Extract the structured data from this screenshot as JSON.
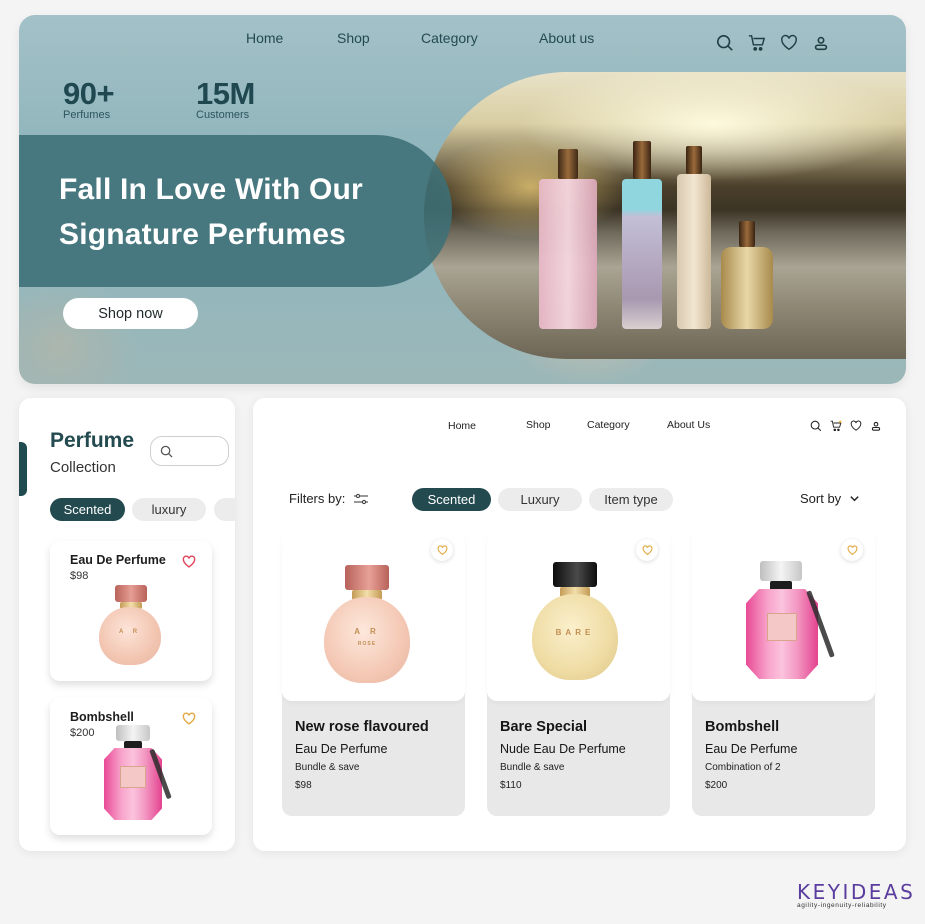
{
  "hero": {
    "nav": [
      {
        "label": "Home"
      },
      {
        "label": "Shop"
      },
      {
        "label": "Category"
      },
      {
        "label": "About us"
      }
    ],
    "icons": [
      "search-icon",
      "cart-icon",
      "heart-icon",
      "user-icon"
    ],
    "stats": [
      {
        "value": "90+",
        "label": "Perfumes"
      },
      {
        "value": "15M",
        "label": "Customers"
      }
    ],
    "title_line1": "Fall In Love With Our",
    "title_line2_regular": "Signature ",
    "title_line2_bold": "Perfumes",
    "cta_label": "Shop now",
    "colors": {
      "band": "#3e7076",
      "heading": "#1f4850"
    }
  },
  "collection_panel": {
    "title": "Perfume",
    "subtitle": "Collection",
    "search_placeholder": "",
    "chips": [
      {
        "label": "Scented",
        "active": true
      },
      {
        "label": "luxury",
        "active": false
      },
      {
        "label": "",
        "active": false
      }
    ],
    "items": [
      {
        "name": "Eau De Perfume",
        "price": "$98",
        "heart_color": "#e0455a"
      },
      {
        "name": "Bombshell",
        "price": "$200",
        "heart_color": "#e2a942"
      }
    ]
  },
  "shop_panel": {
    "nav": [
      {
        "label": "Home"
      },
      {
        "label": "Shop"
      },
      {
        "label": "Category"
      },
      {
        "label": "About Us"
      }
    ],
    "icons": [
      "search-icon",
      "cart-icon",
      "heart-icon",
      "user-icon"
    ],
    "filters_label": "Filters by:",
    "filter_chips": [
      {
        "label": "Scented",
        "active": true
      },
      {
        "label": "Luxury",
        "active": false
      },
      {
        "label": "Item type",
        "active": false
      }
    ],
    "sort_label": "Sort by",
    "products": [
      {
        "title": "New rose flavoured",
        "subtitle": "Eau De Perfume",
        "note": "Bundle & save",
        "price": "$98",
        "bottle_label": "A R",
        "bottle_sub": "ROSE"
      },
      {
        "title": "Bare Special",
        "subtitle": "Nude Eau De Perfume",
        "note": "Bundle & save",
        "price": "$110",
        "bottle_label": "BARE",
        "bottle_sub": ""
      },
      {
        "title": "Bombshell",
        "subtitle": "Eau De Perfume",
        "note": "Combination of 2",
        "price": "$200",
        "bottle_label": "",
        "bottle_sub": ""
      }
    ],
    "accent": "#234a4f"
  },
  "brand": {
    "name": "KEYIDEAS",
    "tagline": "agility-ingenuity-reliability",
    "color": "#5a3d9e"
  }
}
